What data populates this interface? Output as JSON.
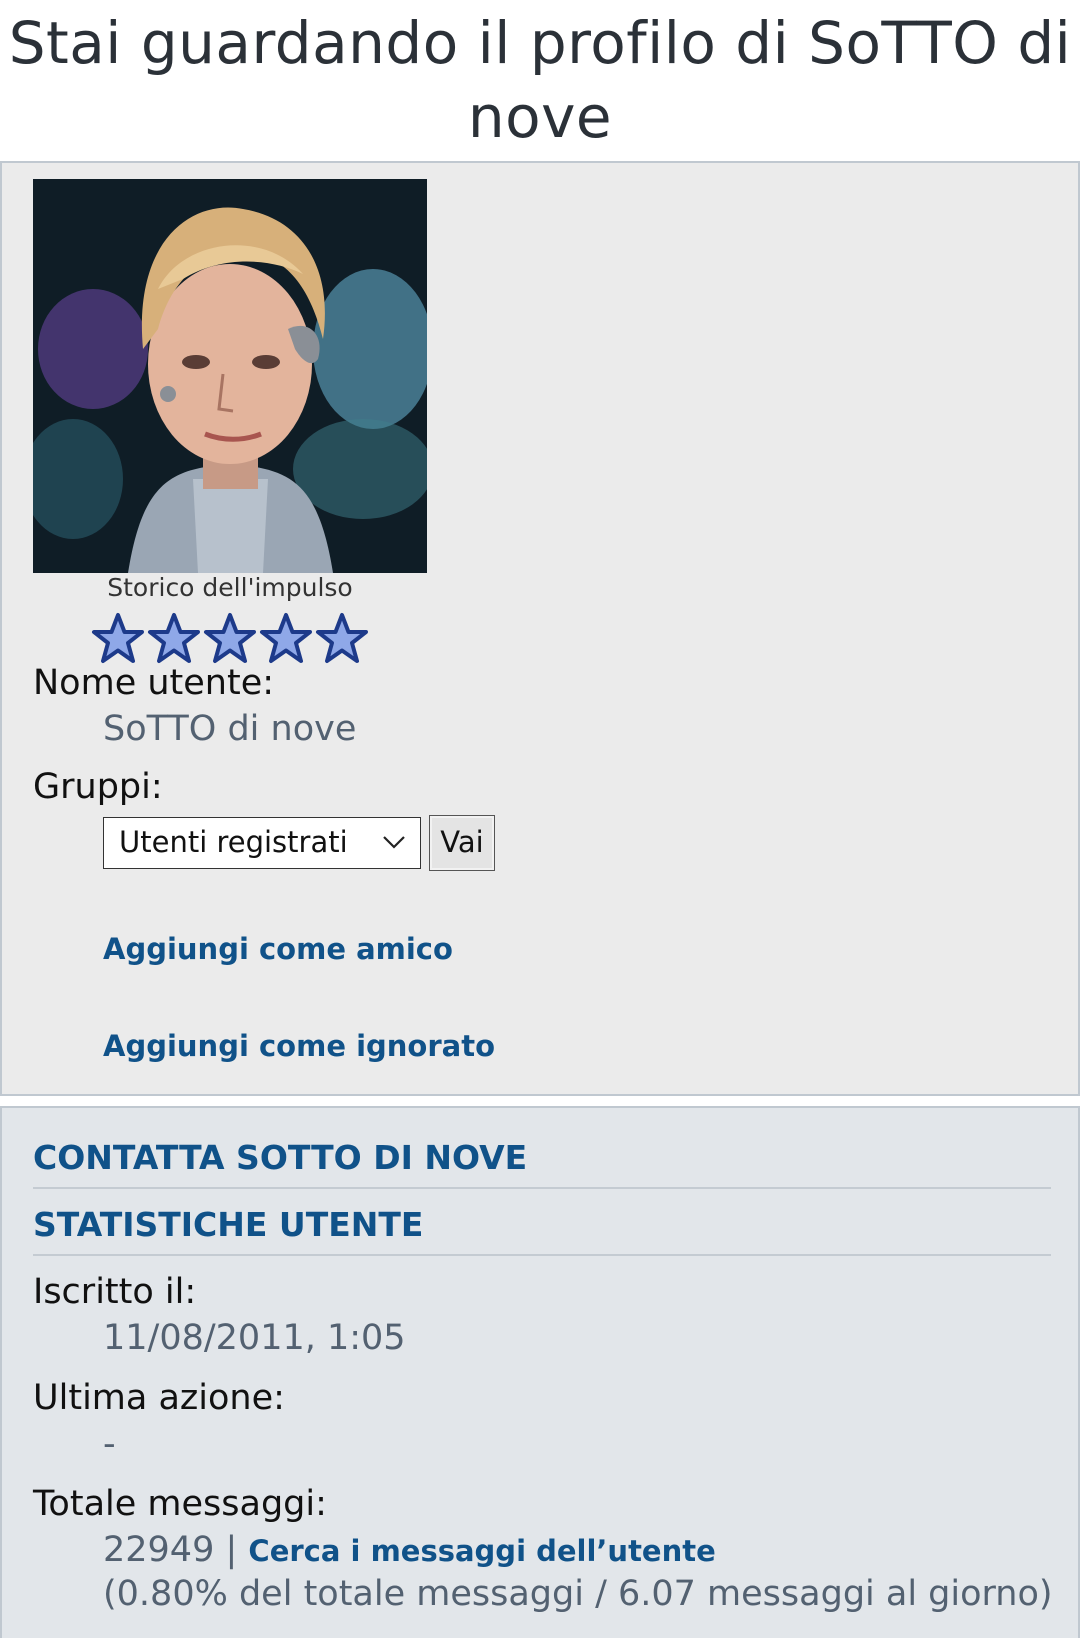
{
  "page": {
    "title": "Stai guardando il profilo di SoTTO di nove"
  },
  "profile": {
    "rank_title": "Storico dell'impulso",
    "rank_stars": 5,
    "username_label": "Nome utente:",
    "username": "SoTTO di nove",
    "groups_label": "Gruppi:",
    "group_selected": "Utenti registrati",
    "go_button": "Vai",
    "add_friend": "Aggiungi come amico",
    "add_foe": "Aggiungi come ignorato"
  },
  "contact": {
    "heading": "CONTATTA SOTTO DI NOVE"
  },
  "stats": {
    "heading": "STATISTICHE UTENTE",
    "joined_label": "Iscritto il:",
    "joined_value": "11/08/2011, 1:05",
    "last_active_label": "Ultima azione:",
    "last_active_value": "-",
    "posts_label": "Totale messaggi:",
    "posts_count": "22949",
    "posts_separator": "|",
    "search_posts": "Cerca i messaggi dell’utente",
    "posts_detail": "(0.80% del totale messaggi / 6.07 messaggi al giorno)"
  },
  "colors": {
    "link": "#105289",
    "value_text": "#536171",
    "panel_bg": "#ebebeb",
    "panel2_bg": "#e2e6ea",
    "star_fill": "#8fa8e8"
  }
}
